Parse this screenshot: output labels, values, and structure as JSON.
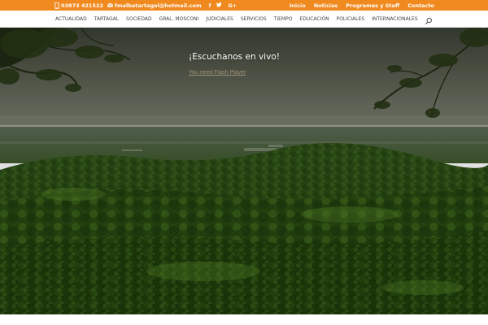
{
  "topbar": {
    "phone": "03873 421522",
    "email": "fmalbatartagal@hotmail.com",
    "social": [
      {
        "name": "facebook-icon",
        "glyph": "f"
      },
      {
        "name": "twitter-icon",
        "glyph": "t"
      },
      {
        "name": "google-plus-icon",
        "glyph": "G+"
      }
    ],
    "links": [
      "Inicio",
      "Noticias",
      "Programas y Staff",
      "Contacto"
    ],
    "bg_color": "#f0891e"
  },
  "nav": {
    "items": [
      "ACTUALIDAD",
      "TARTAGAL",
      "SOCIEDAD",
      "GRAL. MOSCONI",
      "JUDICIALES",
      "SERVICIOS",
      "TIEMPO",
      "EDUCACIÓN",
      "POLICIALES",
      "INTERNACIONALES"
    ],
    "search_icon": "search-icon"
  },
  "hero": {
    "headline": "¡Escuchanos en vivo!",
    "flash_link": "You need Flash Player"
  }
}
